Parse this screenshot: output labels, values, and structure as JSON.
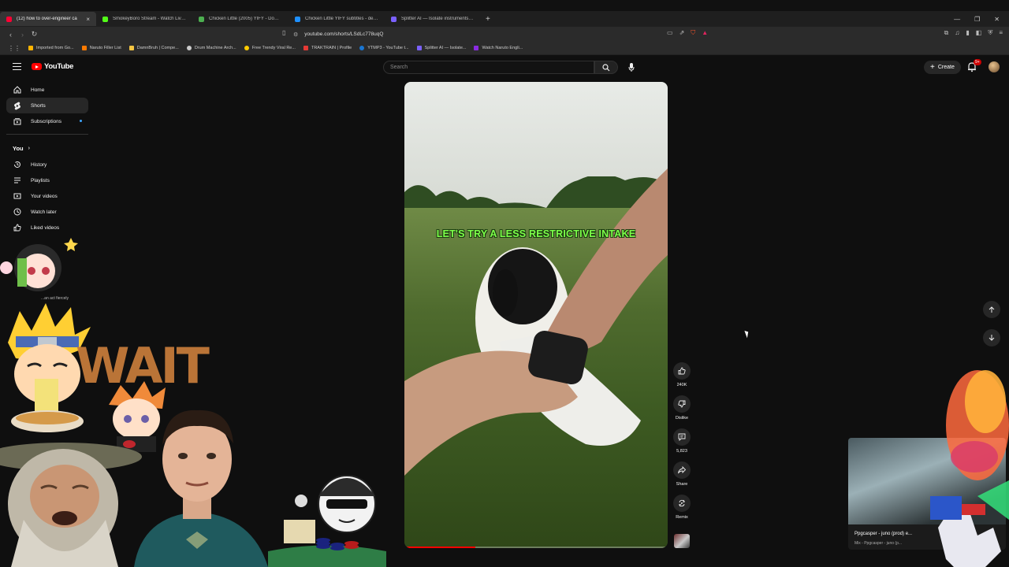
{
  "browser": {
    "tabs": [
      {
        "label": "(12) how to over-engineer ca",
        "color": "#ff0033",
        "active": true
      },
      {
        "label": "SmokeyBoro Stream - Watch Live on",
        "color": "#53fc18",
        "active": false
      },
      {
        "label": "Chicken Little (2005) YIFY - Downloa",
        "color": "#4caf50",
        "active": false
      },
      {
        "label": "Chicken Little YIFY subtitles - details",
        "color": "#1e90ff",
        "active": false
      },
      {
        "label": "Splitter AI — Isolate instruments from",
        "color": "#7b61ff",
        "active": false
      }
    ],
    "new_tab": "+",
    "url": "youtube.com/shorts/LSdLc778uqQ",
    "bookmarks": [
      {
        "label": "Imported from Go...",
        "color": "#ffb400"
      },
      {
        "label": "Naruto Filler List",
        "color": "#ff7a00"
      },
      {
        "label": "DamnBruh | Compe...",
        "color": "#f5c542"
      },
      {
        "label": "Drum Machine Arch...",
        "color": "#cccccc"
      },
      {
        "label": "Free Trendy Viral Re...",
        "color": "#ffcc00"
      },
      {
        "label": "TRAKTRAIN | Profile",
        "color": "#e53935"
      },
      {
        "label": "YTMP3 - YouTube t...",
        "color": "#1976d2"
      },
      {
        "label": "Splitter AI — Isolate...",
        "color": "#7b61ff"
      },
      {
        "label": "Watch Naruto Engli...",
        "color": "#8a2be2"
      }
    ]
  },
  "youtube": {
    "logo_text": "YouTube",
    "search_placeholder": "Search",
    "create_label": "Create",
    "notif_count": "9+",
    "sidebar": {
      "main": [
        {
          "label": "Home",
          "icon": "home-icon",
          "active": false
        },
        {
          "label": "Shorts",
          "icon": "shorts-icon",
          "active": true
        },
        {
          "label": "Subscriptions",
          "icon": "subscriptions-icon",
          "active": false,
          "dot": true
        }
      ],
      "you_header": "You",
      "you": [
        {
          "label": "History",
          "icon": "history-icon"
        },
        {
          "label": "Playlists",
          "icon": "playlists-icon"
        },
        {
          "label": "Your videos",
          "icon": "your-videos-icon"
        },
        {
          "label": "Watch later",
          "icon": "watch-later-icon"
        },
        {
          "label": "Liked videos",
          "icon": "liked-videos-icon"
        }
      ]
    },
    "short": {
      "caption": "LET'S TRY A LESS RESTRICTIVE INTAKE",
      "progress": 0.27
    },
    "actions": {
      "likes": "240K",
      "dislike": "Dislike",
      "comments": "5,823",
      "share": "Share",
      "remix": "Remix"
    },
    "mini_player": {
      "title": "Ppgcasper - juno (prod) e...",
      "subtitle": "Mix - Ppgcasper - juno (p..."
    }
  },
  "overlay": {
    "wait_text": "WAIT",
    "tagline": "...an act fiercely"
  },
  "colors": {
    "background": "#0f0f0f",
    "brand_red": "#ff0000",
    "caption_green": "#7dff4a"
  }
}
